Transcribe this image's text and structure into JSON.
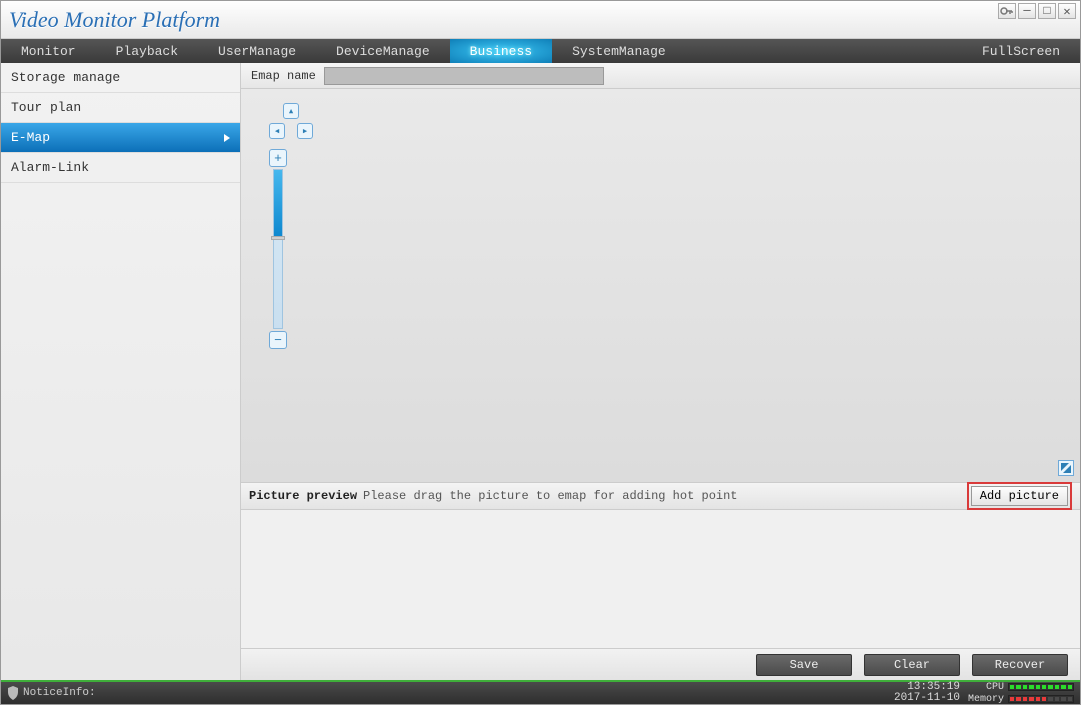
{
  "app": {
    "title": "Video Monitor Platform"
  },
  "menu": {
    "monitor": "Monitor",
    "playback": "Playback",
    "usermanage": "UserManage",
    "devicemanage": "DeviceManage",
    "business": "Business",
    "systemmanage": "SystemManage",
    "fullscreen": "FullScreen"
  },
  "sidebar": {
    "storage": "Storage manage",
    "tour": "Tour plan",
    "emap": "E-Map",
    "alarm": "Alarm-Link"
  },
  "emap": {
    "name_label": "Emap name",
    "name_value": ""
  },
  "preview": {
    "title": "Picture preview",
    "hint": "Please drag the picture to emap for adding hot point",
    "add_btn": "Add picture"
  },
  "actions": {
    "save": "Save",
    "clear": "Clear",
    "recover": "Recover"
  },
  "status": {
    "notice_label": "NoticeInfo:",
    "time": "13:35:19",
    "date": "2017-11-10",
    "cpu_label": "CPU",
    "mem_label": "Memory"
  }
}
